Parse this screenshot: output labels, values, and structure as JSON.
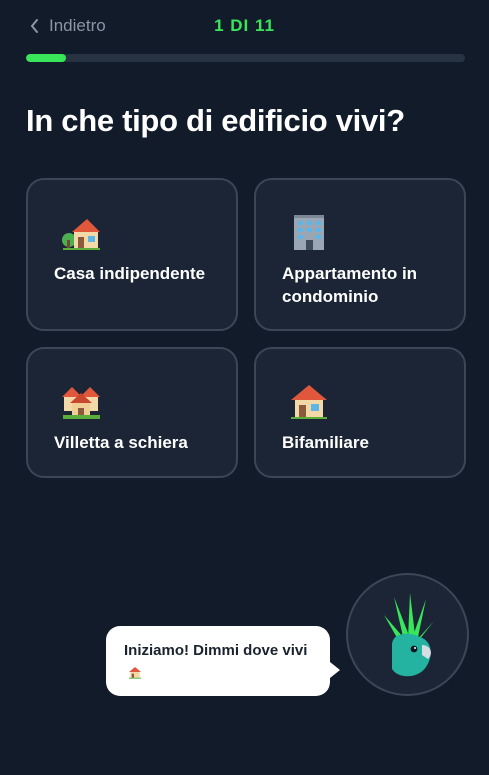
{
  "header": {
    "back_label": "Indietro",
    "step_label": "1 DI 11",
    "progress": 0.09
  },
  "question": "In che tipo di edificio vivi?",
  "options": [
    {
      "label": "Casa indipendente",
      "icon": "house-with-garden-icon"
    },
    {
      "label": "Appartamento in condominio",
      "icon": "office-building-icon"
    },
    {
      "label": "Villetta a schiera",
      "icon": "houses-icon"
    },
    {
      "label": "Bifamiliare",
      "icon": "house-icon"
    }
  ],
  "assistant": {
    "message": "Iniziamo! Dimmi dove vivi",
    "icon": "cockatoo-mascot-icon"
  },
  "colors": {
    "background": "#111b29",
    "accent": "#39e65a",
    "card": "#1b2535",
    "card_border": "#3b4657"
  }
}
